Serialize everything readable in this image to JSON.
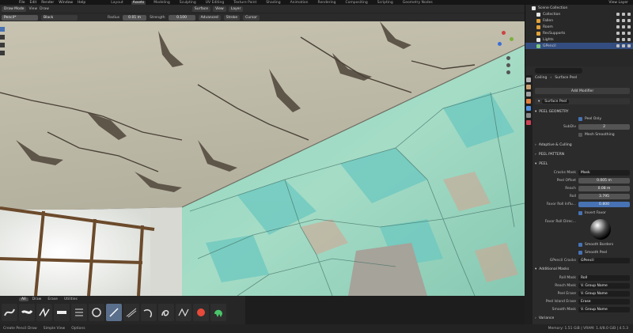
{
  "topbar": {
    "menus": [
      "File",
      "Edit",
      "Render",
      "Window",
      "Help"
    ],
    "workspaces": [
      {
        "label": "Layout",
        "active": false
      },
      {
        "label": "Assets",
        "active": true
      },
      {
        "label": "Modeling",
        "active": false
      },
      {
        "label": "Sculpting",
        "active": false
      },
      {
        "label": "UV Editing",
        "active": false
      },
      {
        "label": "Texture Paint",
        "active": false
      },
      {
        "label": "Shading",
        "active": false
      },
      {
        "label": "Animation",
        "active": false
      },
      {
        "label": "Rendering",
        "active": false
      },
      {
        "label": "Compositing",
        "active": false
      },
      {
        "label": "Scripting",
        "active": false
      },
      {
        "label": "Geometry Nodes",
        "active": false
      }
    ],
    "view_layer": "View Layer"
  },
  "header": {
    "mode": "Draw Mode",
    "menus": [
      "View",
      "Draw"
    ],
    "surface": "Surface",
    "view": "View",
    "layer": "Layer"
  },
  "toolrow": {
    "brush": "Pencil*",
    "color": "Black",
    "radius_label": "Radius",
    "radius": "0.01 m",
    "strength_label": "Strength",
    "strength": "0.100",
    "advanced": "Advanced",
    "stroke": "Stroke",
    "cursor": "Cursor"
  },
  "outliner": {
    "title": "Scene Collection",
    "items": [
      {
        "label": "Collection",
        "color": "#e6e6e6",
        "selected": false
      },
      {
        "label": "Fallen",
        "color": "#e0a23b",
        "selected": false
      },
      {
        "label": "Room",
        "color": "#e0a23b",
        "selected": false
      },
      {
        "label": "RecSupports",
        "color": "#e0a23b",
        "selected": false
      },
      {
        "label": "Lights",
        "color": "#e6e6e6",
        "selected": false
      },
      {
        "label": "GPencil",
        "color": "#7ec77e",
        "selected": true
      }
    ]
  },
  "properties": {
    "search_placeholder": "",
    "breadcrumb_obj": "Ceiling",
    "breadcrumb_mod": "Surface Peel",
    "add_modifier": "Add Modifier",
    "modifier_name": "Surface Peel",
    "sections": {
      "geometry": "Peel Geometry",
      "peel_only": "Peel Only",
      "subdiv_label": "SubDiv",
      "subdiv": "2",
      "mesh_smoothing": "Mesh Smoothing",
      "adaptive": "Adaptive & Culling",
      "pattern": "Peel Pattern",
      "peel": "Peel",
      "cracks_mask_label": "Cracks Mask",
      "cracks_mask": "Mask",
      "peel_offset_label": "Peel Offset",
      "peel_offset": "0.005 m",
      "reach_label": "Reach",
      "reach": "0.08 m",
      "roll_label": "Roll",
      "roll": "3.795",
      "favor_roll_label": "Favor Roll Influ...",
      "favor_roll": "0.800",
      "invert_favor": "Invert Favor",
      "favor_roll_dir_label": "Favor Roll Direc...",
      "smooth_borders": "Smooth Borders",
      "smooth_peel": "Smooth Peel",
      "gpencil_cracks_label": "GPencil Cracks",
      "gpencil_cracks": "GPencil",
      "additional_masks": "Additional Masks",
      "roll_mask_label": "Roll Mask",
      "roll_mask": "Roll",
      "reach_mask_label": "Reach Mask",
      "reach_mask": "V. Group Name",
      "peel_erase_label": "Peel Erase",
      "peel_erase": "V. Group Name",
      "peel_island_label": "Peel Island Erase",
      "peel_island": "Erase",
      "smooth_mask_label": "Smooth Mask",
      "smooth_mask": "V. Group Name",
      "variance": "Variance"
    }
  },
  "shelf": {
    "tabs": [
      {
        "label": "All",
        "active": true
      },
      {
        "label": "Draw",
        "active": false
      },
      {
        "label": "Erase",
        "active": false
      },
      {
        "label": "Utilities",
        "active": false
      }
    ]
  },
  "status": {
    "left": "Create Pencil Draw",
    "mid": "Simple View",
    "options": "Options",
    "version": "Memory: 1.51 GiB | VRAM: 1.4/8.0 GiB | 4.5.3"
  },
  "colors": {
    "accent": "#4772b3",
    "selected_row": "#334d80"
  }
}
